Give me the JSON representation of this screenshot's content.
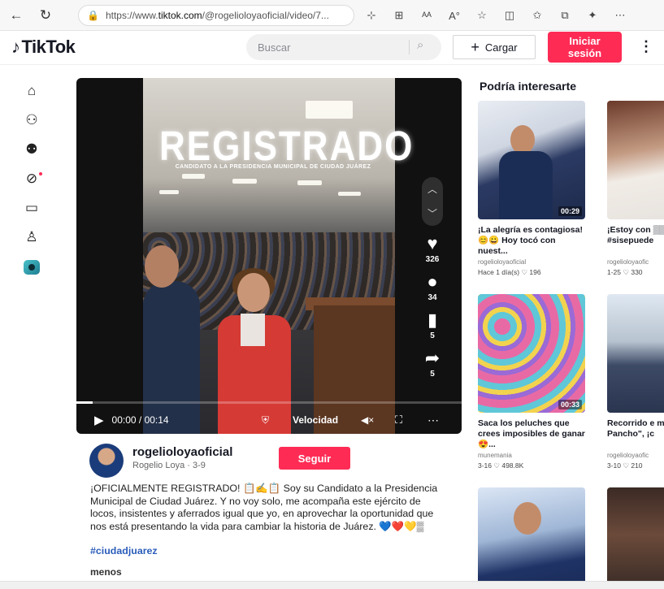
{
  "browser": {
    "url_prefix": "https://www.",
    "url_domain": "tiktok.com",
    "url_rest": "/@rogelioloyaoficial/video/7...",
    "icons": [
      "star-add-icon",
      "grid-icon",
      "read-aloud-icon",
      "text-icon",
      "favorite-icon",
      "split-icon",
      "favorites-icon",
      "collections-icon",
      "extensions-icon",
      "more-icon"
    ]
  },
  "header": {
    "logo": "TikTok",
    "search_placeholder": "Buscar",
    "upload_label": "Cargar",
    "login_line1": "Iniciar",
    "login_line2": "sesión",
    "accent": "#fe2c55"
  },
  "video": {
    "overlay_title": "REGISTRADO",
    "overlay_sub": "CANDIDATO A LA PRESIDENCIA MUNICIPAL DE CIUDAD JUÁREZ",
    "likes": "326",
    "comments": "34",
    "saves": "5",
    "shares": "5",
    "time": "00:00 / 00:14",
    "speed_label": "Velocidad"
  },
  "author": {
    "username": "rogelioloyaoficial",
    "display": "Rogelio Loya · 3-9",
    "follow_label": "Seguir"
  },
  "caption": {
    "text": "¡OFICIALMENTE REGISTRADO! 📋✍️📋 Soy su Candidato a la Presidencia Municipal de Ciudad Juárez. Y no voy solo, me acompaña este ejército de locos, insistentes y aferrados igual que yo, en aprovechar la oportunidad que nos está presentando la vida para cambiar la historia de Juárez. 💙❤️💛▒",
    "hashtag": "#ciudadjuarez",
    "less_label": "menos"
  },
  "suggestions": {
    "title": "Podría interesarte",
    "items": [
      {
        "title": "¡La alegría es contagiosa! 😊😀 Hoy tocó con nuest...",
        "author": "rogelioloyaoficial",
        "meta": "Hace 1 día(s)  ♡ 196",
        "duration": "00:29"
      },
      {
        "title": "¡Estoy con ▒▒ #ciudadj #sisepuede",
        "author": "rogelioloyaofic",
        "meta": "1-25  ♡ 330",
        "duration": ""
      },
      {
        "title": "Saca los peluches que crees imposibles de ganar 😍...",
        "author": "munemania",
        "meta": "3-16  ♡ 498.8K",
        "duration": "00:33"
      },
      {
        "title": "Recorrido e mercado \"S Pancho\", ¡c",
        "author": "rogelioloyaofic",
        "meta": "3-10  ♡ 210",
        "duration": ""
      },
      {
        "title": "",
        "author": "",
        "meta": "",
        "duration": ""
      },
      {
        "title": "",
        "author": "",
        "meta": "",
        "duration": ""
      }
    ]
  }
}
